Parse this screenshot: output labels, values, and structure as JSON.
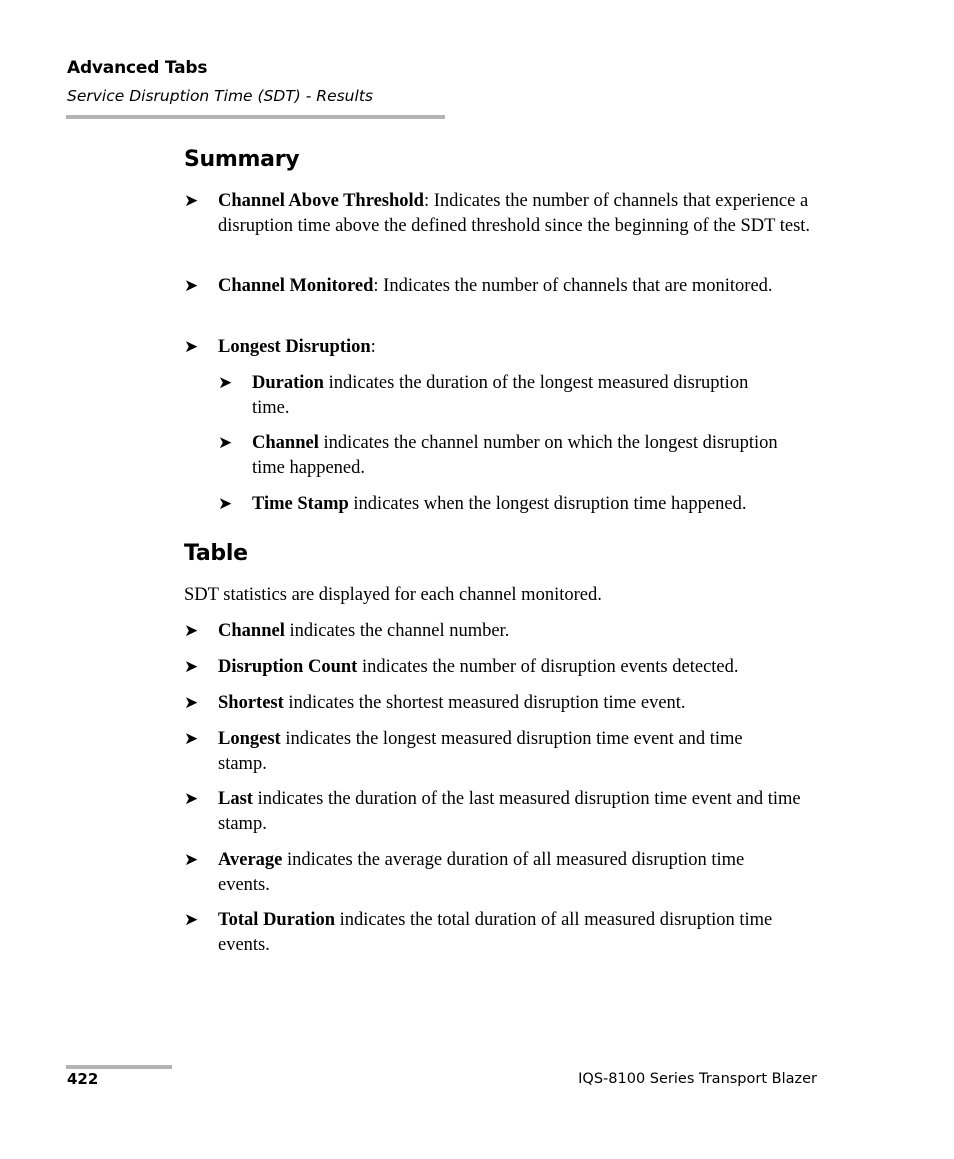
{
  "header": {
    "title": "Advanced Tabs",
    "subtitle": "Service Disruption Time (SDT) - Results"
  },
  "summary": {
    "title": "Summary",
    "items": [
      {
        "term": "Channel Above Threshold",
        "sep": ": ",
        "desc": "Indicates the number of channels that experience a disruption time above the defined threshold since the beginning of the SDT test."
      },
      {
        "term": "Channel Monitored",
        "sep": ": ",
        "desc": "Indicates the number of channels that are monitored."
      },
      {
        "term": "Longest Disruption",
        "sep": ":",
        "desc": ""
      }
    ],
    "subitems": [
      {
        "term": "Duration",
        "desc": " indicates the duration of the longest measured disruption time."
      },
      {
        "term": "Channel",
        "desc": " indicates the channel number on which the longest disruption time happened."
      },
      {
        "term": "Time Stamp",
        "desc": " indicates when the longest disruption time happened."
      }
    ]
  },
  "table": {
    "title": "Table",
    "intro": "SDT statistics are displayed for each channel monitored.",
    "items": [
      {
        "term": "Channel",
        "desc": " indicates the channel number."
      },
      {
        "term": "Disruption Count",
        "desc": " indicates the number of disruption events detected."
      },
      {
        "term": "Shortest",
        "desc": " indicates the shortest measured disruption time event."
      },
      {
        "term": "Longest",
        "desc": " indicates the longest measured disruption time event and time stamp."
      },
      {
        "term": "Last",
        "desc": " indicates the duration of the last measured disruption time event and time stamp."
      },
      {
        "term": "Average",
        "desc": " indicates the average duration of all measured disruption time events."
      },
      {
        "term": "Total Duration",
        "desc": " indicates the total duration of all measured disruption time events."
      }
    ]
  },
  "bullet_glyph": "➤",
  "footer": {
    "page_number": "422",
    "product": "IQS-8100 Series Transport Blazer"
  }
}
